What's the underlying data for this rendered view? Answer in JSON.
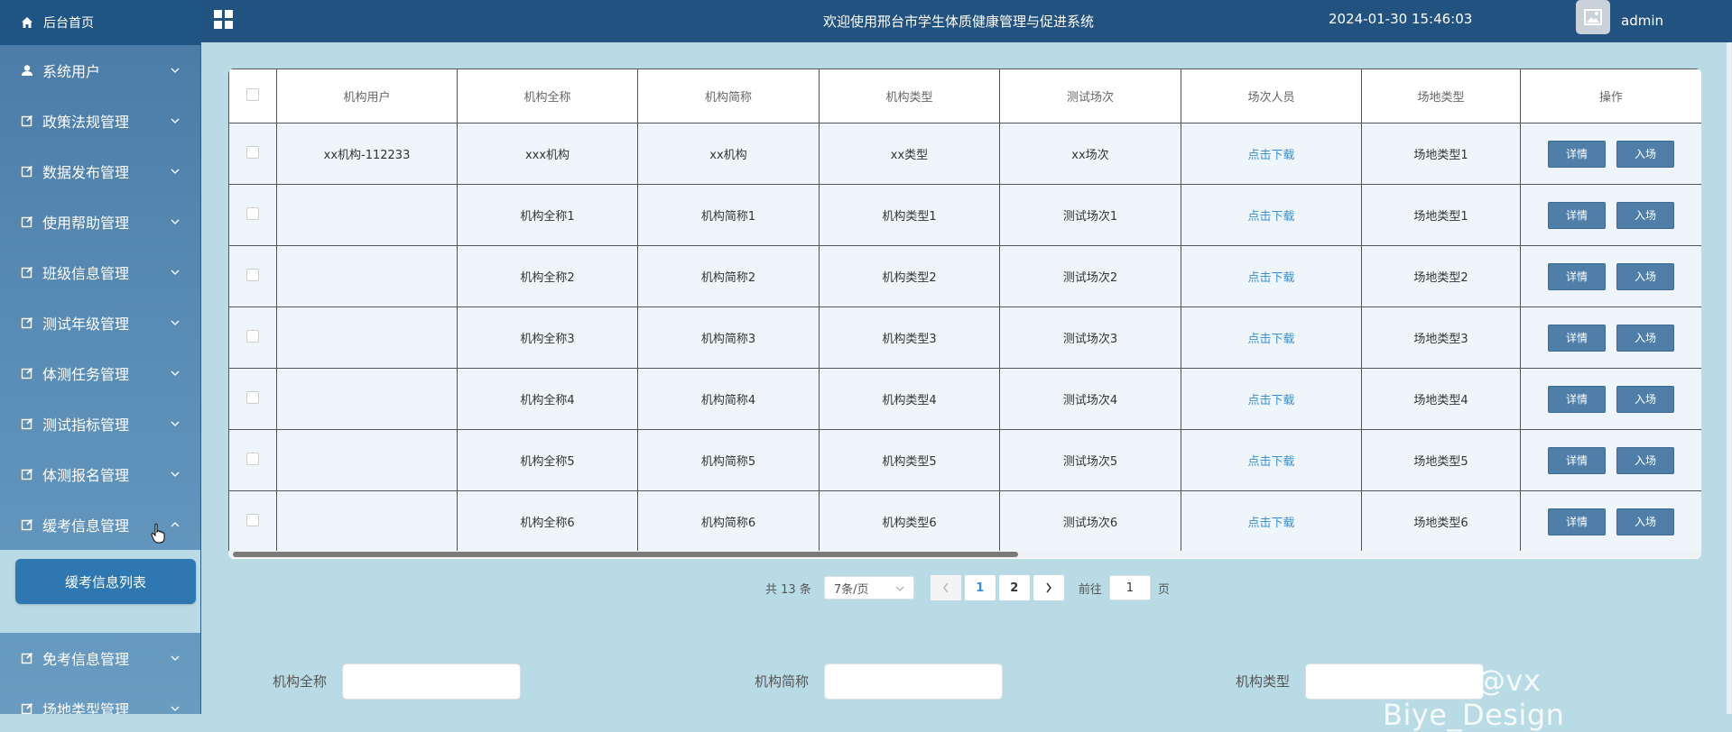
{
  "sidebar": {
    "home_label": "后台首页",
    "items": [
      {
        "label": "系统用户",
        "icon": "user-icon"
      },
      {
        "label": "政策法规管理",
        "icon": "edit-icon"
      },
      {
        "label": "数据发布管理",
        "icon": "edit-icon"
      },
      {
        "label": "使用帮助管理",
        "icon": "edit-icon"
      },
      {
        "label": "班级信息管理",
        "icon": "edit-icon"
      },
      {
        "label": "测试年级管理",
        "icon": "edit-icon"
      },
      {
        "label": "体测任务管理",
        "icon": "edit-icon"
      },
      {
        "label": "测试指标管理",
        "icon": "edit-icon"
      },
      {
        "label": "体测报名管理",
        "icon": "edit-icon"
      },
      {
        "label": "缓考信息管理",
        "icon": "edit-icon"
      }
    ],
    "active_sub": "缓考信息列表",
    "after_items": [
      {
        "label": "免考信息管理"
      },
      {
        "label": "场地类型管理"
      }
    ]
  },
  "header": {
    "title": "欢迎使用邢台市学生体质健康管理与促进系统",
    "datetime": "2024-01-30 15:46:03",
    "username": "admin"
  },
  "table": {
    "headers": [
      "机构用户",
      "机构全称",
      "机构简称",
      "机构类型",
      "测试场次",
      "场次人员",
      "场地类型",
      "操作"
    ],
    "rows": [
      [
        "xx机构-112233",
        "xxx机构",
        "xx机构",
        "xx类型",
        "xx场次",
        "点击下载",
        "场地类型1"
      ],
      [
        "",
        "机构全称1",
        "机构简称1",
        "机构类型1",
        "测试场次1",
        "点击下载",
        "场地类型1"
      ],
      [
        "",
        "机构全称2",
        "机构简称2",
        "机构类型2",
        "测试场次2",
        "点击下载",
        "场地类型2"
      ],
      [
        "",
        "机构全称3",
        "机构简称3",
        "机构类型3",
        "测试场次3",
        "点击下载",
        "场地类型3"
      ],
      [
        "",
        "机构全称4",
        "机构简称4",
        "机构类型4",
        "测试场次4",
        "点击下载",
        "场地类型4"
      ],
      [
        "",
        "机构全称5",
        "机构简称5",
        "机构类型5",
        "测试场次5",
        "点击下载",
        "场地类型5"
      ],
      [
        "",
        "机构全称6",
        "机构简称6",
        "机构类型6",
        "测试场次6",
        "点击下载",
        "场地类型6"
      ]
    ],
    "detail_label": "详情",
    "enter_label": "入场"
  },
  "pagination": {
    "total_text": "共 13 条",
    "page_size": "7条/页",
    "pages": [
      "1",
      "2"
    ],
    "current_page": "1",
    "goto_prefix": "前往",
    "goto_value": "1",
    "goto_suffix": "页"
  },
  "search": {
    "labels": [
      "机构全称",
      "机构简称",
      "机构类型"
    ]
  },
  "watermark": "CSDN @vx Biye_Design",
  "colors": {
    "topbar": "#22527f",
    "sidebar": "#4a7aa6",
    "content_bg": "#b9dbe5",
    "accent": "#2e77b0",
    "link": "#3b8fd6"
  }
}
